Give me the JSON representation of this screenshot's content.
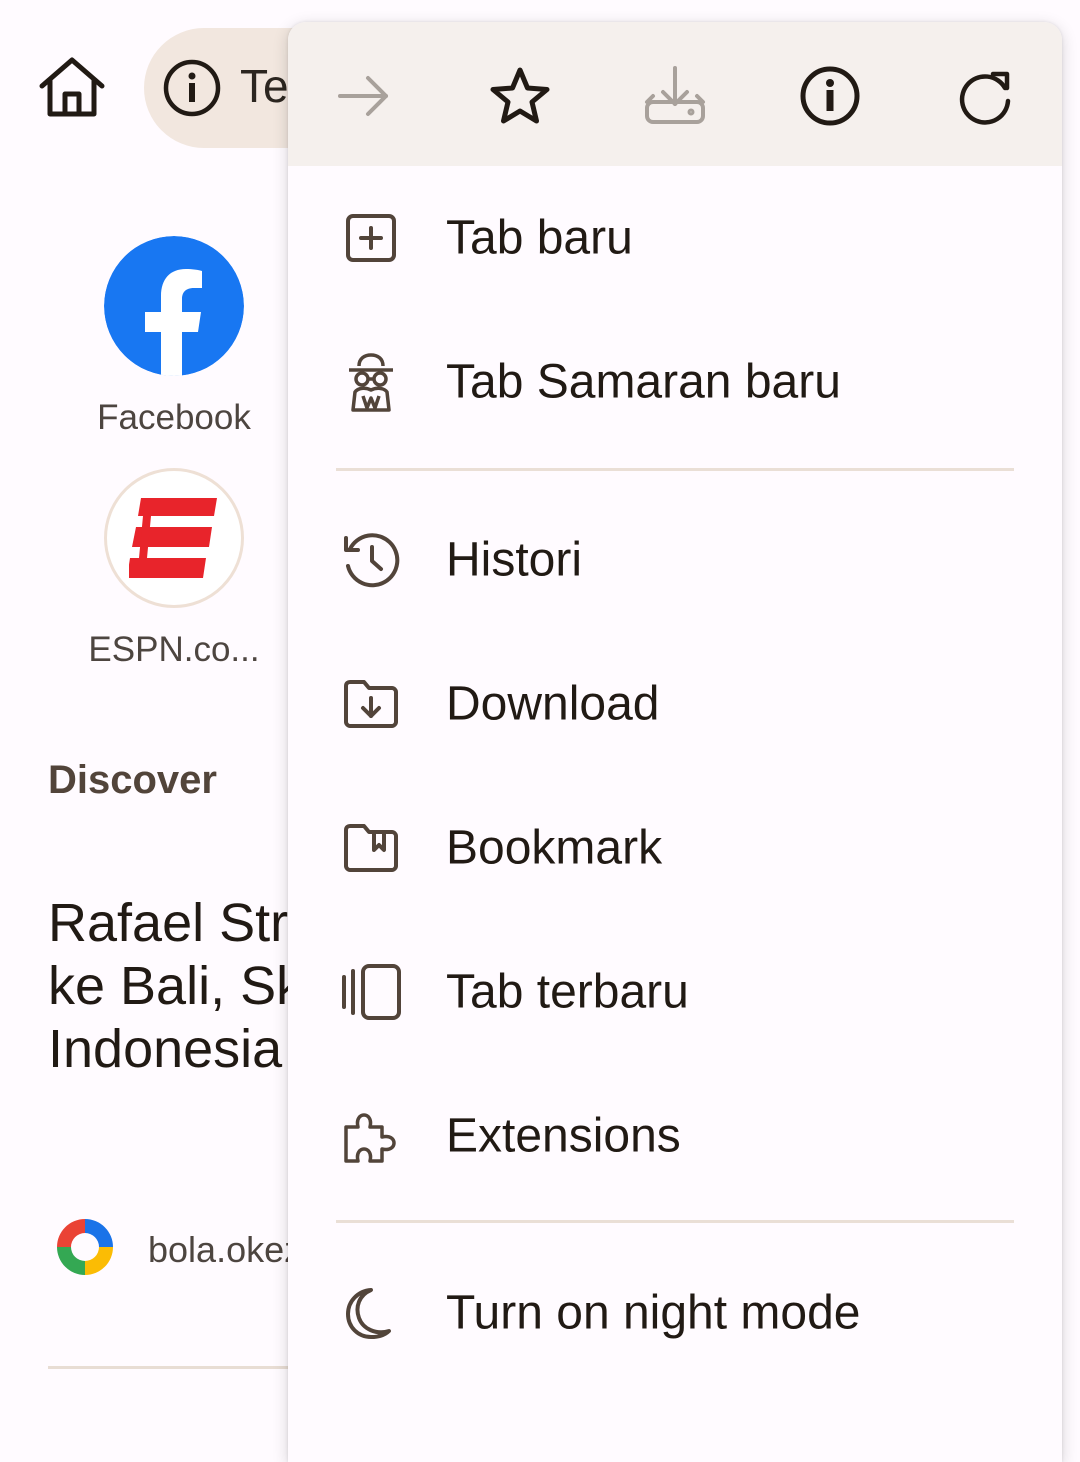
{
  "toolbar": {
    "home_icon": "home-icon",
    "omnibox_icon": "info-icon",
    "url_text": "Te"
  },
  "shortcuts": [
    {
      "label": "Facebook",
      "icon": "facebook-icon",
      "color": "#1877F2"
    },
    {
      "label": "ESPN.co...",
      "icon": "espn-icon",
      "color": "#E8242B"
    }
  ],
  "discover": {
    "heading": "Discover",
    "article": {
      "title_lines": [
        "Rafael Stru",
        "ke Bali, Sk",
        "Indonesia"
      ],
      "source": "bola.okez"
    }
  },
  "menu": {
    "icon_row": [
      {
        "icon": "forward-arrow-icon",
        "enabled": false
      },
      {
        "icon": "star-icon",
        "enabled": true
      },
      {
        "icon": "download-icon",
        "enabled": false
      },
      {
        "icon": "page-info-icon",
        "enabled": true
      },
      {
        "icon": "refresh-icon",
        "enabled": true
      }
    ],
    "items": [
      {
        "label": "Tab baru",
        "icon": "new-tab-icon"
      },
      {
        "label": "Tab Samaran baru",
        "icon": "incognito-icon"
      },
      {
        "label": "Histori",
        "icon": "history-icon"
      },
      {
        "label": "Download",
        "icon": "downloads-folder-icon"
      },
      {
        "label": "Bookmark",
        "icon": "bookmarks-icon"
      },
      {
        "label": "Tab terbaru",
        "icon": "recent-tabs-icon"
      },
      {
        "label": "Extensions",
        "icon": "extensions-icon"
      },
      {
        "label": "Turn on night mode",
        "icon": "moon-icon"
      }
    ]
  }
}
